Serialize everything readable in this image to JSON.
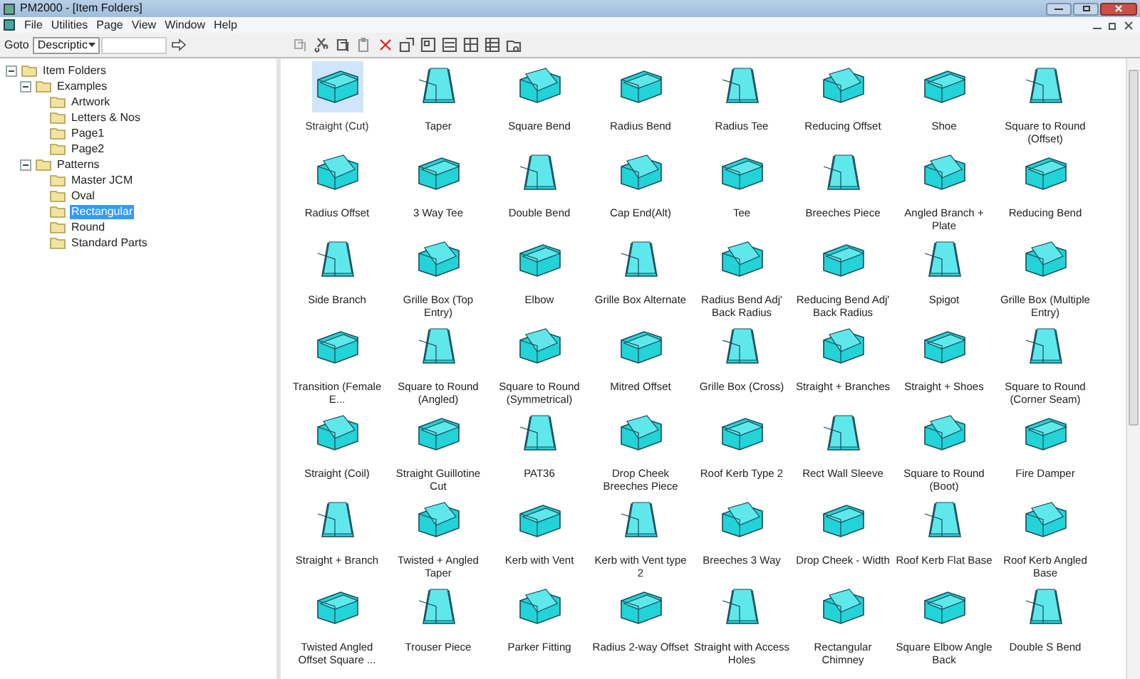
{
  "window": {
    "title": "PM2000 - [Item Folders]"
  },
  "menu": [
    {
      "label": "File"
    },
    {
      "label": "Utilities"
    },
    {
      "label": "Page"
    },
    {
      "label": "View"
    },
    {
      "label": "Window"
    },
    {
      "label": "Help"
    }
  ],
  "goto": {
    "label": "Goto",
    "mode": "Descriptic"
  },
  "tree": [
    {
      "label": "Item Folders",
      "expanded": true,
      "selected": false,
      "children": [
        {
          "label": "Examples",
          "expanded": true,
          "selected": false,
          "children": [
            {
              "label": "Artwork",
              "selected": false
            },
            {
              "label": "Letters & Nos",
              "selected": false
            },
            {
              "label": "Page1",
              "selected": false
            },
            {
              "label": "Page2",
              "selected": false
            }
          ]
        },
        {
          "label": "Patterns",
          "expanded": true,
          "selected": false,
          "children": [
            {
              "label": "Master JCM",
              "selected": false
            },
            {
              "label": "Oval",
              "selected": false
            },
            {
              "label": "Rectangular",
              "selected": true
            },
            {
              "label": "Round",
              "selected": false
            },
            {
              "label": "Standard Parts",
              "selected": false
            }
          ]
        }
      ]
    }
  ],
  "items": [
    {
      "label": "Straight (Cut)",
      "selected": true
    },
    {
      "label": "Taper",
      "selected": false
    },
    {
      "label": "Square Bend",
      "selected": false
    },
    {
      "label": "Radius Bend",
      "selected": false
    },
    {
      "label": "Radius Tee",
      "selected": false
    },
    {
      "label": "Reducing Offset",
      "selected": false
    },
    {
      "label": "Shoe",
      "selected": false
    },
    {
      "label": "Square to Round (Offset)",
      "selected": false
    },
    {
      "label": "Radius Offset",
      "selected": false
    },
    {
      "label": "3 Way Tee",
      "selected": false
    },
    {
      "label": "Double Bend",
      "selected": false
    },
    {
      "label": "Cap End(Alt)",
      "selected": false
    },
    {
      "label": "Tee",
      "selected": false
    },
    {
      "label": "Breeches Piece",
      "selected": false
    },
    {
      "label": "Angled Branch + Plate",
      "selected": false
    },
    {
      "label": "Reducing Bend",
      "selected": false
    },
    {
      "label": "Side Branch",
      "selected": false
    },
    {
      "label": "Grille Box (Top Entry)",
      "selected": false
    },
    {
      "label": "Elbow",
      "selected": false
    },
    {
      "label": "Grille Box Alternate",
      "selected": false
    },
    {
      "label": "Radius Bend Adj' Back Radius",
      "selected": false
    },
    {
      "label": "Reducing Bend Adj' Back Radius",
      "selected": false
    },
    {
      "label": "Spigot",
      "selected": false
    },
    {
      "label": "Grille Box (Multiple Entry)",
      "selected": false
    },
    {
      "label": "Transition (Female E...",
      "selected": false
    },
    {
      "label": "Square to Round (Angled)",
      "selected": false
    },
    {
      "label": "Square to Round (Symmetrical)",
      "selected": false
    },
    {
      "label": "Mitred Offset",
      "selected": false
    },
    {
      "label": "Grille Box (Cross)",
      "selected": false
    },
    {
      "label": "Straight + Branches",
      "selected": false
    },
    {
      "label": "Straight + Shoes",
      "selected": false
    },
    {
      "label": "Square to Round (Corner Seam)",
      "selected": false
    },
    {
      "label": "Straight (Coil)",
      "selected": false
    },
    {
      "label": "Straight Guillotine Cut",
      "selected": false
    },
    {
      "label": "PAT36",
      "selected": false
    },
    {
      "label": "Drop Cheek Breeches Piece",
      "selected": false
    },
    {
      "label": "Roof Kerb Type 2",
      "selected": false
    },
    {
      "label": "Rect Wall Sleeve",
      "selected": false
    },
    {
      "label": "Square to Round (Boot)",
      "selected": false
    },
    {
      "label": "Fire Damper",
      "selected": false
    },
    {
      "label": "Straight + Branch",
      "selected": false
    },
    {
      "label": "Twisted + Angled Taper",
      "selected": false
    },
    {
      "label": "Kerb with Vent",
      "selected": false
    },
    {
      "label": "Kerb with Vent type 2",
      "selected": false
    },
    {
      "label": "Breeches 3 Way",
      "selected": false
    },
    {
      "label": "Drop Cheek - Width",
      "selected": false
    },
    {
      "label": "Roof Kerb Flat Base",
      "selected": false
    },
    {
      "label": "Roof Kerb Angled Base",
      "selected": false
    },
    {
      "label": "Twisted Angled Offset Square ...",
      "selected": false
    },
    {
      "label": "Trouser Piece",
      "selected": false
    },
    {
      "label": "Parker Fitting",
      "selected": false
    },
    {
      "label": "Radius 2-way Offset",
      "selected": false
    },
    {
      "label": "Straight with Access Holes",
      "selected": false
    },
    {
      "label": "Rectangular Chimney",
      "selected": false
    },
    {
      "label": "Square Elbow Angle Back",
      "selected": false
    },
    {
      "label": "Double S Bend",
      "selected": false
    }
  ]
}
